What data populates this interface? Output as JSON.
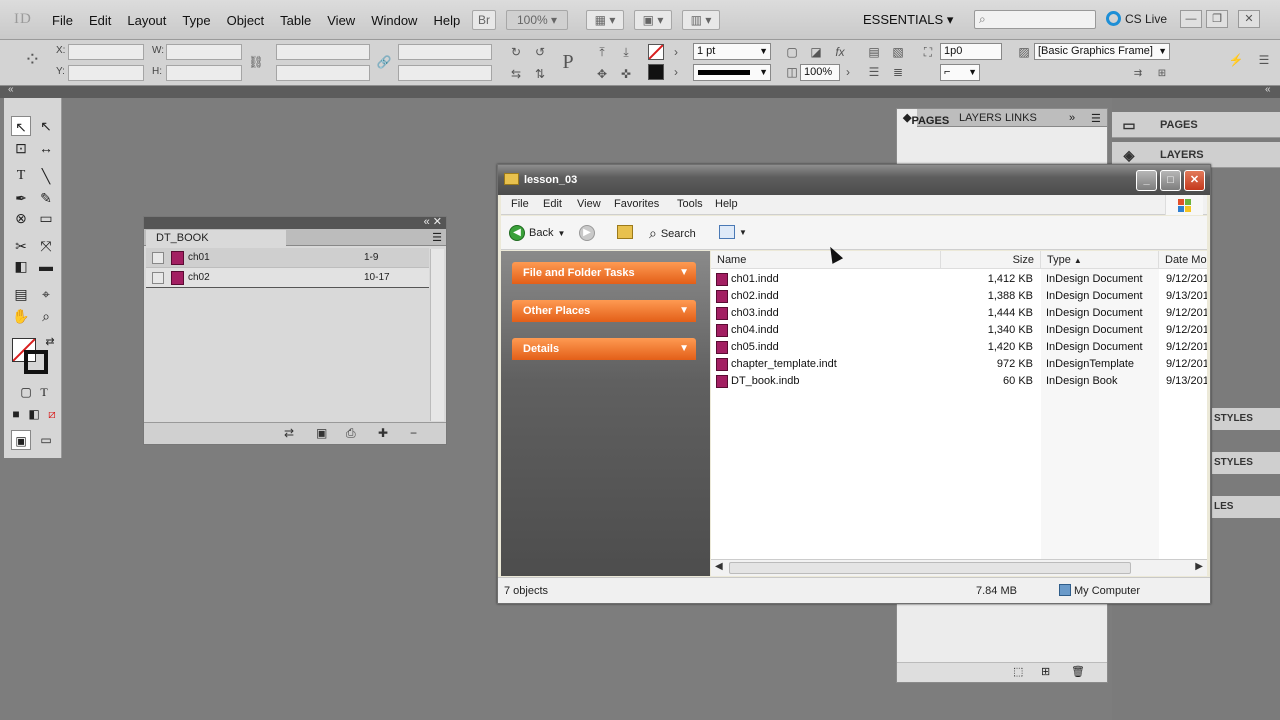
{
  "app": {
    "logo": "ID",
    "menus": [
      "File",
      "Edit",
      "Layout",
      "Type",
      "Object",
      "Table",
      "View",
      "Window",
      "Help"
    ],
    "bridge_label": "Br",
    "zoom": "100%",
    "workspace": "ESSENTIALS",
    "cs_live": "CS Live"
  },
  "control": {
    "x_label": "X:",
    "y_label": "Y:",
    "w_label": "W:",
    "h_label": "H:",
    "stroke_weight": "1 pt",
    "scale_percent": "100%",
    "gap_value": "1p0",
    "object_style": "[Basic Graphics Frame]"
  },
  "book_panel": {
    "title": "DT_BOOK",
    "rows": [
      {
        "name": "ch01",
        "pages": "1-9"
      },
      {
        "name": "ch02",
        "pages": "10-17"
      }
    ]
  },
  "pages_panel": {
    "tabs": [
      "PAGES",
      "LAYERS",
      "LINKS"
    ]
  },
  "icon_panel": {
    "items": [
      "PAGES",
      "LAYERS"
    ],
    "styles_labels": [
      "STYLES",
      "STYLES",
      "LES"
    ]
  },
  "explorer": {
    "title": "lesson_03",
    "menus": [
      "File",
      "Edit",
      "View",
      "Favorites",
      "Tools",
      "Help"
    ],
    "toolbar": {
      "back": "Back",
      "search": "Search"
    },
    "tasks": [
      "File and Folder Tasks",
      "Other Places",
      "Details"
    ],
    "columns": [
      "Name",
      "Size",
      "Type",
      "Date Mo"
    ],
    "files": [
      {
        "name": "ch01.indd",
        "size": "1,412 KB",
        "type": "InDesign Document",
        "date": "9/12/201"
      },
      {
        "name": "ch02.indd",
        "size": "1,388 KB",
        "type": "InDesign Document",
        "date": "9/13/201"
      },
      {
        "name": "ch03.indd",
        "size": "1,444 KB",
        "type": "InDesign Document",
        "date": "9/12/201"
      },
      {
        "name": "ch04.indd",
        "size": "1,340 KB",
        "type": "InDesign Document",
        "date": "9/12/201"
      },
      {
        "name": "ch05.indd",
        "size": "1,420 KB",
        "type": "InDesign Document",
        "date": "9/12/201"
      },
      {
        "name": "chapter_template.indt",
        "size": "972 KB",
        "type": "InDesignTemplate",
        "date": "9/12/201"
      },
      {
        "name": "DT_book.indb",
        "size": "60 KB",
        "type": "InDesign Book",
        "date": "9/13/201"
      }
    ],
    "status": {
      "objects": "7 objects",
      "size": "7.84 MB",
      "location": "My Computer"
    }
  }
}
